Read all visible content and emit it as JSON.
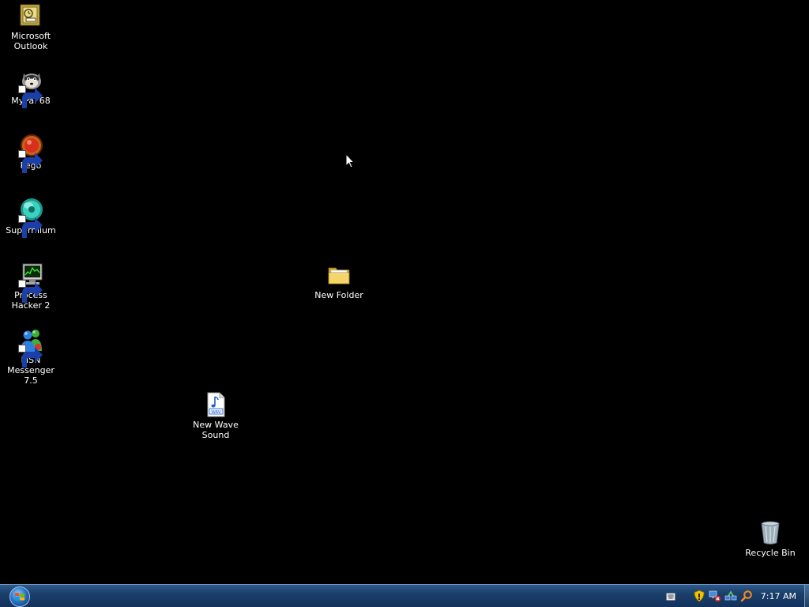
{
  "desktop": {
    "icons": [
      {
        "label": "Microsoft\nOutlook",
        "icon": "outlook-icon",
        "shortcut": false
      },
      {
        "label": "MyPal 68",
        "icon": "mypal-browser-icon",
        "shortcut": true
      },
      {
        "label": "Pego",
        "icon": "pego-icon",
        "shortcut": true
      },
      {
        "label": "Supermium",
        "icon": "supermium-browser-icon",
        "shortcut": true
      },
      {
        "label": "Process\nHacker 2",
        "icon": "process-hacker-icon",
        "shortcut": true
      },
      {
        "label": "MSN\nMessenger 7.5",
        "icon": "msn-messenger-icon",
        "shortcut": true
      },
      {
        "label": "New Wave\nSound",
        "icon": "wav-file-icon",
        "shortcut": false
      },
      {
        "label": "New Folder",
        "icon": "folder-icon",
        "shortcut": false
      },
      {
        "label": "Recycle Bin",
        "icon": "recycle-bin-icon",
        "shortcut": false
      }
    ]
  },
  "taskbar": {
    "start_icon": "windows-start-orb-icon",
    "tray_icons": [
      "keyboard-icon",
      "security-shield-icon",
      "network-disconnected-icon",
      "network-icon",
      "search-icon"
    ],
    "clock": "7:17 AM"
  },
  "colors": {
    "desktop_background": "#000000",
    "taskbar": "#1b3f6a",
    "label_text": "#ffffff"
  }
}
